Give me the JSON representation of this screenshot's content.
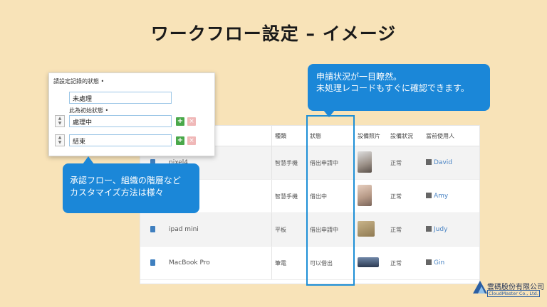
{
  "title": "ワークフロー設定 – イメージ",
  "settings": {
    "label": "請設定記錄的狀態 •",
    "first_value": "未處理",
    "initial_label": "此為初始狀態 •",
    "second_value": "處理中",
    "third_value": "結束",
    "add_symbol": "+",
    "remove_symbol": "×",
    "spinner_up": "▲",
    "spinner_down": "▼"
  },
  "table": {
    "headers": {
      "type": "種類",
      "status": "狀態",
      "photo": "設備照片",
      "condition": "設備狀況",
      "user": "當前使用人"
    },
    "rows": [
      {
        "name": "pixel4",
        "type": "智慧手機",
        "status": "借出申請中",
        "condition": "正常",
        "user": "David"
      },
      {
        "name": "",
        "type": "智慧手機",
        "status": "借出中",
        "condition": "正常",
        "user": "Amy"
      },
      {
        "name": "ipad mini",
        "type": "平板",
        "status": "借出申請中",
        "condition": "正常",
        "user": "Judy"
      },
      {
        "name": "MacBook Pro",
        "type": "筆電",
        "status": "可以借出",
        "condition": "正常",
        "user": "Gin"
      }
    ]
  },
  "callout_top": {
    "line1": "申請状況が一目瞭然。",
    "line2": "未処理レコードもすぐに確認できます。"
  },
  "callout_left": {
    "line1": "承認フロー、組織の階層など",
    "line2": "カスタマイズ方法は様々"
  },
  "logo": {
    "name_cn": "雲碼股份有限公司",
    "name_en": "CloudMaster Co., Ltd."
  },
  "colors": {
    "background": "#f8e3b8",
    "accent": "#1b87d8",
    "highlight": "#1e8fd6"
  }
}
